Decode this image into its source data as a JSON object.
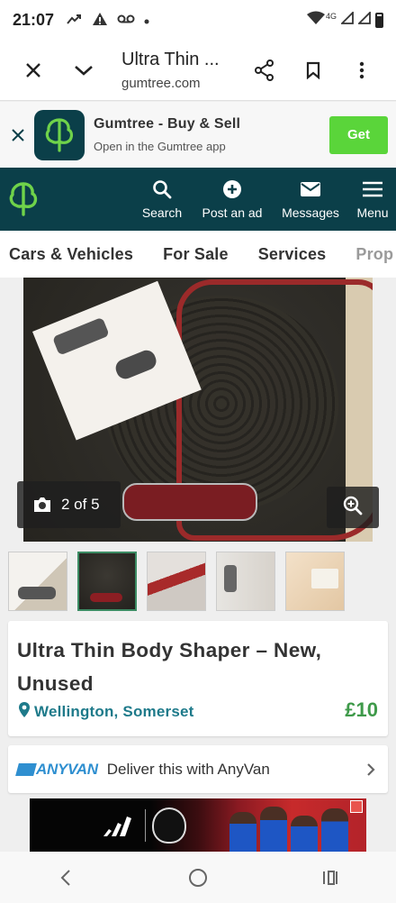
{
  "status_bar": {
    "time": "21:07",
    "network_label": "4G",
    "icons": [
      "missed-call-icon",
      "warning-icon",
      "voicemail-icon",
      "dot-icon",
      "wifi-icon",
      "signal-icon",
      "battery-icon"
    ]
  },
  "browser": {
    "title": "Ultra Thin ...",
    "url": "gumtree.com",
    "icons": [
      "close-icon",
      "chevron-down-icon",
      "share-icon",
      "bookmark-icon",
      "more-vert-icon"
    ]
  },
  "app_banner": {
    "title": "Gumtree - Buy & Sell",
    "subtitle": "Open in the Gumtree app",
    "get_label": "Get",
    "button_color": "#5ad53a"
  },
  "site_header": {
    "background": "#0b3f49",
    "items": [
      {
        "label": "Search",
        "icon": "search-icon"
      },
      {
        "label": "Post an ad",
        "icon": "plus-circle-icon"
      },
      {
        "label": "Messages",
        "icon": "envelope-icon"
      },
      {
        "label": "Menu",
        "icon": "hamburger-icon"
      }
    ]
  },
  "categories": [
    "Cars & Vehicles",
    "For Sale",
    "Services",
    "Prop"
  ],
  "gallery": {
    "counter": "2 of 5",
    "current_index": 2,
    "total": 5,
    "thumbnail_count": 5
  },
  "listing": {
    "title": "Ultra Thin Body Shaper – New, Unused",
    "location": "Wellington, Somerset",
    "price": "£10",
    "price_color": "#3f9a4a",
    "location_color": "#1e7a8a"
  },
  "anyvan": {
    "logo": "ANYVAN",
    "text": "Deliver this with AnyVan",
    "brand_color": "#2f8fd0"
  },
  "nav_bar": {
    "icons": [
      "back-icon",
      "home-icon",
      "recents-icon"
    ]
  }
}
